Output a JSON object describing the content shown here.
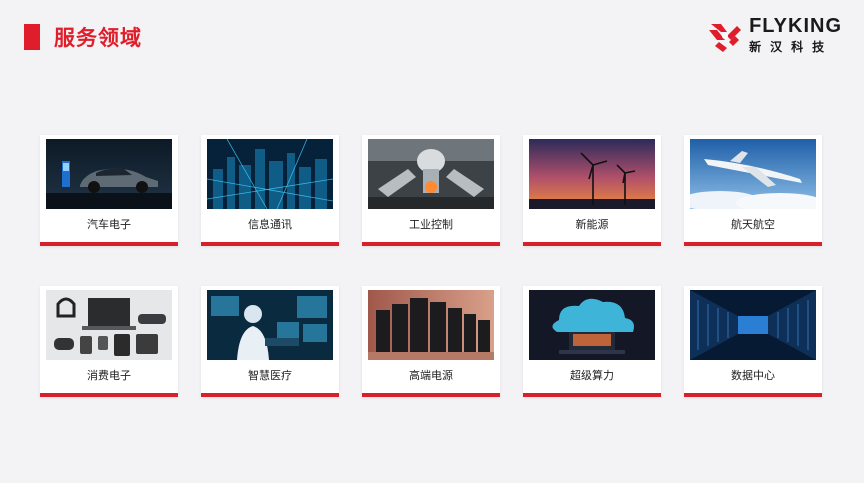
{
  "header": {
    "title": "服务领域"
  },
  "logo": {
    "brand_en": "FLYKING",
    "brand_cn": "新汉科技",
    "color": "#e01e2b"
  },
  "accent_color": "#d8202c",
  "cards": [
    {
      "label": "汽车电子",
      "icon": "car-image"
    },
    {
      "label": "信息通讯",
      "icon": "data-city-image"
    },
    {
      "label": "工业控制",
      "icon": "industrial-robot-image"
    },
    {
      "label": "新能源",
      "icon": "wind-turbine-image"
    },
    {
      "label": "航天航空",
      "icon": "airplane-image"
    },
    {
      "label": "消费电子",
      "icon": "consumer-devices-image"
    },
    {
      "label": "智慧医疗",
      "icon": "smart-medical-image"
    },
    {
      "label": "高端电源",
      "icon": "power-supply-image"
    },
    {
      "label": "超级算力",
      "icon": "supercomputing-cloud-image"
    },
    {
      "label": "数据中心",
      "icon": "data-center-image"
    }
  ]
}
